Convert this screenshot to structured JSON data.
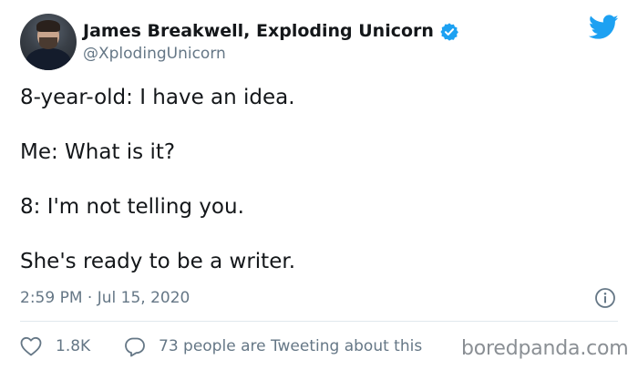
{
  "author": {
    "name": "James Breakwell, Exploding Unicorn",
    "handle": "@XplodingUnicorn",
    "verified": true,
    "avatar": "profile-photo"
  },
  "tweet": {
    "lines": [
      "8-year-old: I have an idea.",
      "Me: What is it?",
      "8: I'm not telling you.",
      "She's ready to be a writer."
    ],
    "timestamp": "2:59 PM · Jul 15, 2020"
  },
  "actions": {
    "like_count": "1.8K",
    "reply_text": "73 people are Tweeting about this"
  },
  "watermark": "boredpanda.com",
  "icons": {
    "brand": "twitter-bird-icon",
    "verified": "verified-badge-icon",
    "info": "info-icon",
    "like": "heart-icon",
    "reply": "reply-bubble-icon"
  },
  "colors": {
    "twitter_blue": "#1da1f2",
    "text_primary": "#14171a",
    "text_secondary": "#657786",
    "divider": "#e1e8ed"
  }
}
